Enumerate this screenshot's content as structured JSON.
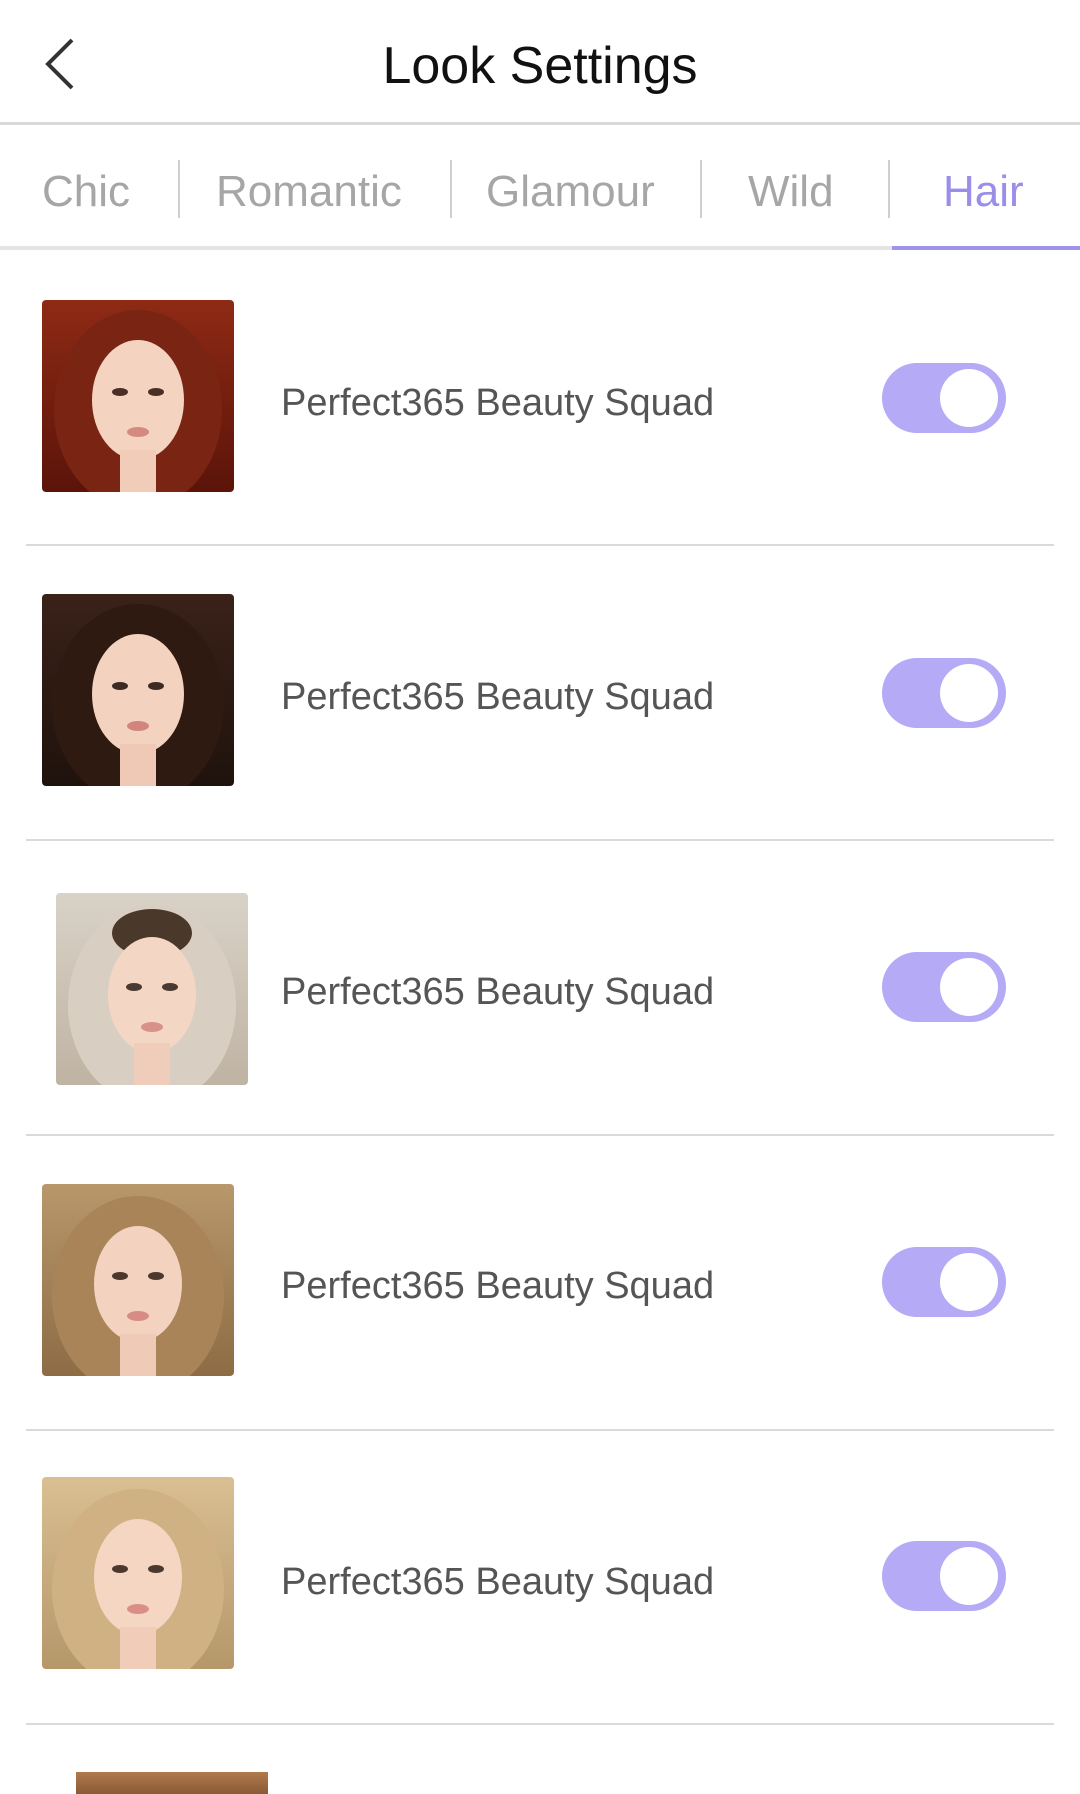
{
  "header": {
    "title": "Look Settings"
  },
  "tabs": [
    {
      "label": "Chic",
      "active": false
    },
    {
      "label": "Romantic",
      "active": false
    },
    {
      "label": "Glamour",
      "active": false
    },
    {
      "label": "Wild",
      "active": false
    },
    {
      "label": "Hair",
      "active": true
    }
  ],
  "colors": {
    "accent": "#9d93ec",
    "switch_on": "#b4aaf6"
  },
  "looks": [
    {
      "label": "Perfect365 Beauty Squad",
      "enabled": true,
      "hair": "auburn"
    },
    {
      "label": "Perfect365 Beauty Squad",
      "enabled": true,
      "hair": "dark brown"
    },
    {
      "label": "Perfect365 Beauty Squad",
      "enabled": true,
      "hair": "platinum ombre"
    },
    {
      "label": "Perfect365 Beauty Squad",
      "enabled": true,
      "hair": "honey wavy"
    },
    {
      "label": "Perfect365 Beauty Squad",
      "enabled": true,
      "hair": "golden blonde"
    }
  ]
}
